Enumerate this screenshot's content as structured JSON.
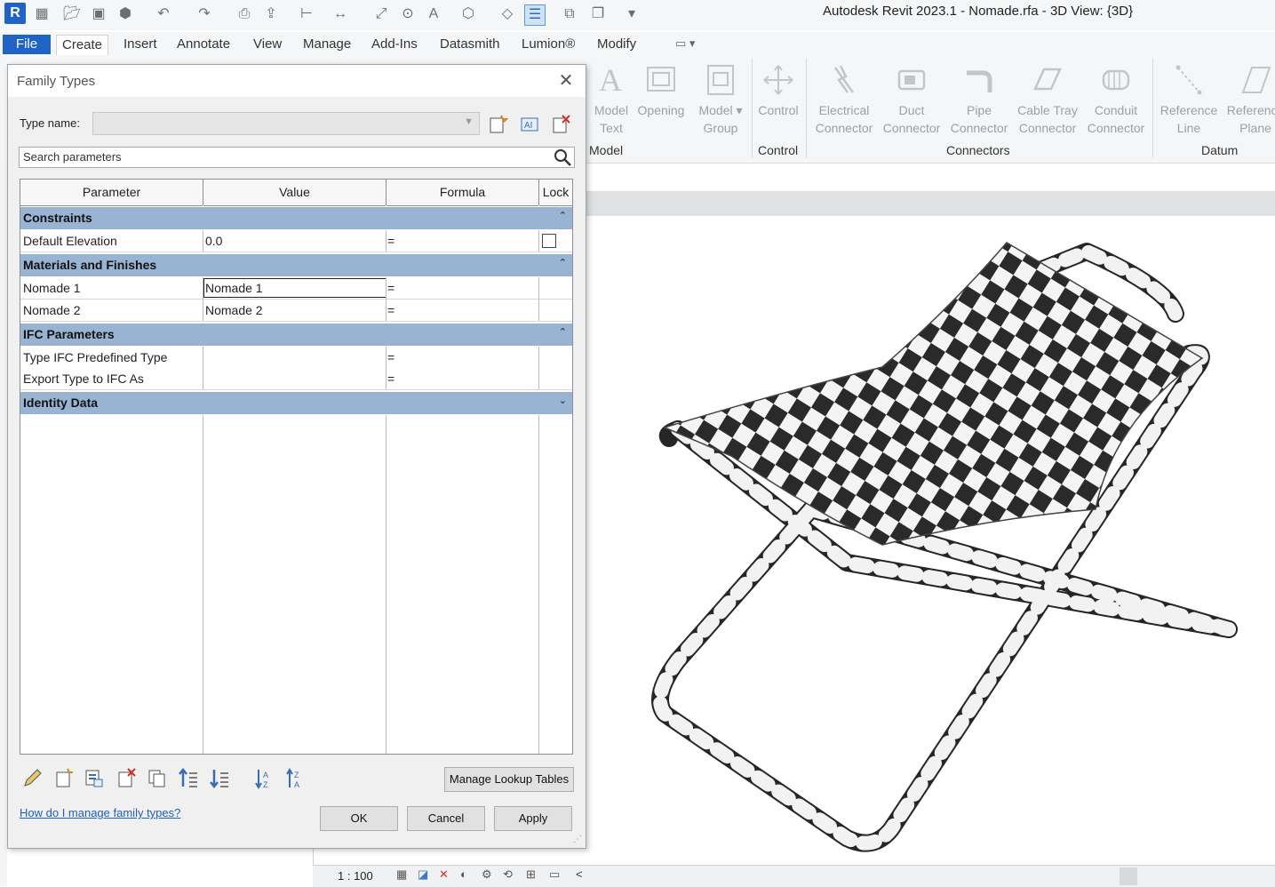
{
  "window": {
    "title": "Autodesk Revit 2023.1 - Nomade.rfa - 3D View: {3D}"
  },
  "app_logo": "R",
  "ribbon_tabs": [
    "File",
    "Create",
    "Insert",
    "Annotate",
    "View",
    "Manage",
    "Add-Ins",
    "Datasmith",
    "Lumion®",
    "Modify"
  ],
  "ribbon": {
    "buttons": [
      {
        "line1": "Model",
        "line2": "Text"
      },
      {
        "line1": "Opening",
        "line2": ""
      },
      {
        "line1": "Model",
        "line2": "Group"
      },
      {
        "line1": "Control",
        "line2": ""
      },
      {
        "line1": "Electrical",
        "line2": "Connector"
      },
      {
        "line1": "Duct",
        "line2": "Connector"
      },
      {
        "line1": "Pipe",
        "line2": "Connector"
      },
      {
        "line1": "Cable Tray",
        "line2": "Connector"
      },
      {
        "line1": "Conduit",
        "line2": "Connector"
      },
      {
        "line1": "Reference",
        "line2": "Line"
      },
      {
        "line1": "Reference",
        "line2": "Plane"
      }
    ],
    "panels": [
      "Model",
      "Control",
      "Connectors",
      "Datum"
    ]
  },
  "dialog": {
    "title": "Family Types",
    "type_name_label": "Type name:",
    "type_name_value": "",
    "search_placeholder": "Search parameters",
    "columns": [
      "Parameter",
      "Value",
      "Formula",
      "Lock"
    ],
    "groups": [
      {
        "title": "Constraints",
        "rows": [
          {
            "parameter": "Default Elevation",
            "value": "0.0",
            "formula": "=",
            "lock": false
          }
        ]
      },
      {
        "title": "Materials and Finishes",
        "rows": [
          {
            "parameter": "Nomade 1",
            "value": "Nomade 1",
            "formula": "="
          },
          {
            "parameter": "Nomade 2",
            "value": "Nomade 2",
            "formula": "="
          }
        ]
      },
      {
        "title": "IFC Parameters",
        "rows": [
          {
            "parameter": "Type IFC Predefined Type",
            "value": "",
            "formula": "="
          },
          {
            "parameter": "Export Type to IFC As",
            "value": "",
            "formula": "="
          }
        ]
      },
      {
        "title": "Identity Data",
        "rows": []
      }
    ],
    "manage_lookup_label": "Manage Lookup Tables",
    "help_link": "How do I manage family types?",
    "ok_label": "OK",
    "cancel_label": "Cancel",
    "apply_label": "Apply"
  },
  "status": {
    "scale": "1 : 100",
    "collapse_glyph": "<"
  },
  "colors": {
    "accent": "#1e63c5",
    "group_header": "#99b3d2"
  }
}
